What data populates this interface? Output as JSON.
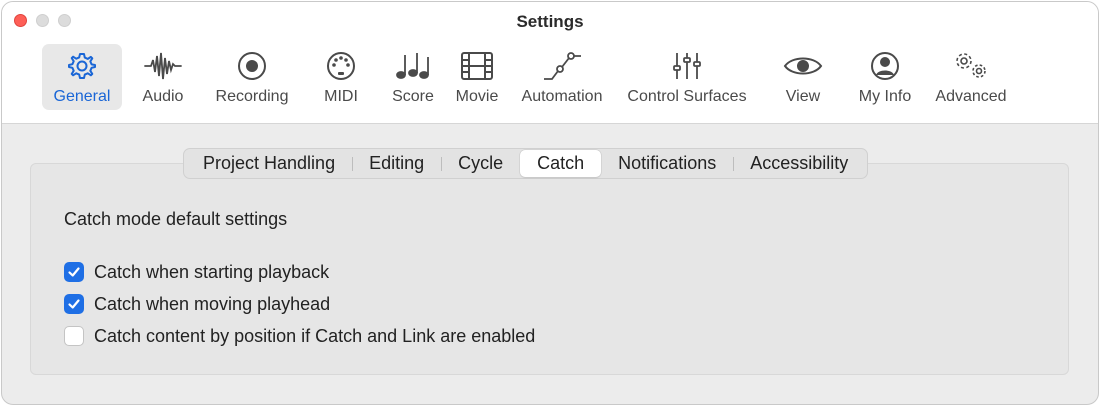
{
  "window": {
    "title": "Settings"
  },
  "toolbar": {
    "items": [
      {
        "label": "General",
        "icon": "gear-icon",
        "active": true
      },
      {
        "label": "Audio",
        "icon": "waveform-icon"
      },
      {
        "label": "Recording",
        "icon": "record-icon"
      },
      {
        "label": "MIDI",
        "icon": "midi-icon"
      },
      {
        "label": "Score",
        "icon": "notes-icon"
      },
      {
        "label": "Movie",
        "icon": "film-icon"
      },
      {
        "label": "Automation",
        "icon": "automation-icon"
      },
      {
        "label": "Control Surfaces",
        "icon": "faders-icon"
      },
      {
        "label": "View",
        "icon": "eye-icon"
      },
      {
        "label": "My Info",
        "icon": "person-icon"
      },
      {
        "label": "Advanced",
        "icon": "gears-icon"
      }
    ]
  },
  "tabs": {
    "items": [
      "Project Handling",
      "Editing",
      "Cycle",
      "Catch",
      "Notifications",
      "Accessibility"
    ],
    "selected": "Catch"
  },
  "catch": {
    "section_title": "Catch mode default settings",
    "options": [
      {
        "label": "Catch when starting playback",
        "checked": true
      },
      {
        "label": "Catch when moving playhead",
        "checked": true
      },
      {
        "label": "Catch content by position if Catch and Link are enabled",
        "checked": false
      }
    ]
  },
  "colors": {
    "accent": "#1f6fe5",
    "close": "#fe5f57"
  }
}
